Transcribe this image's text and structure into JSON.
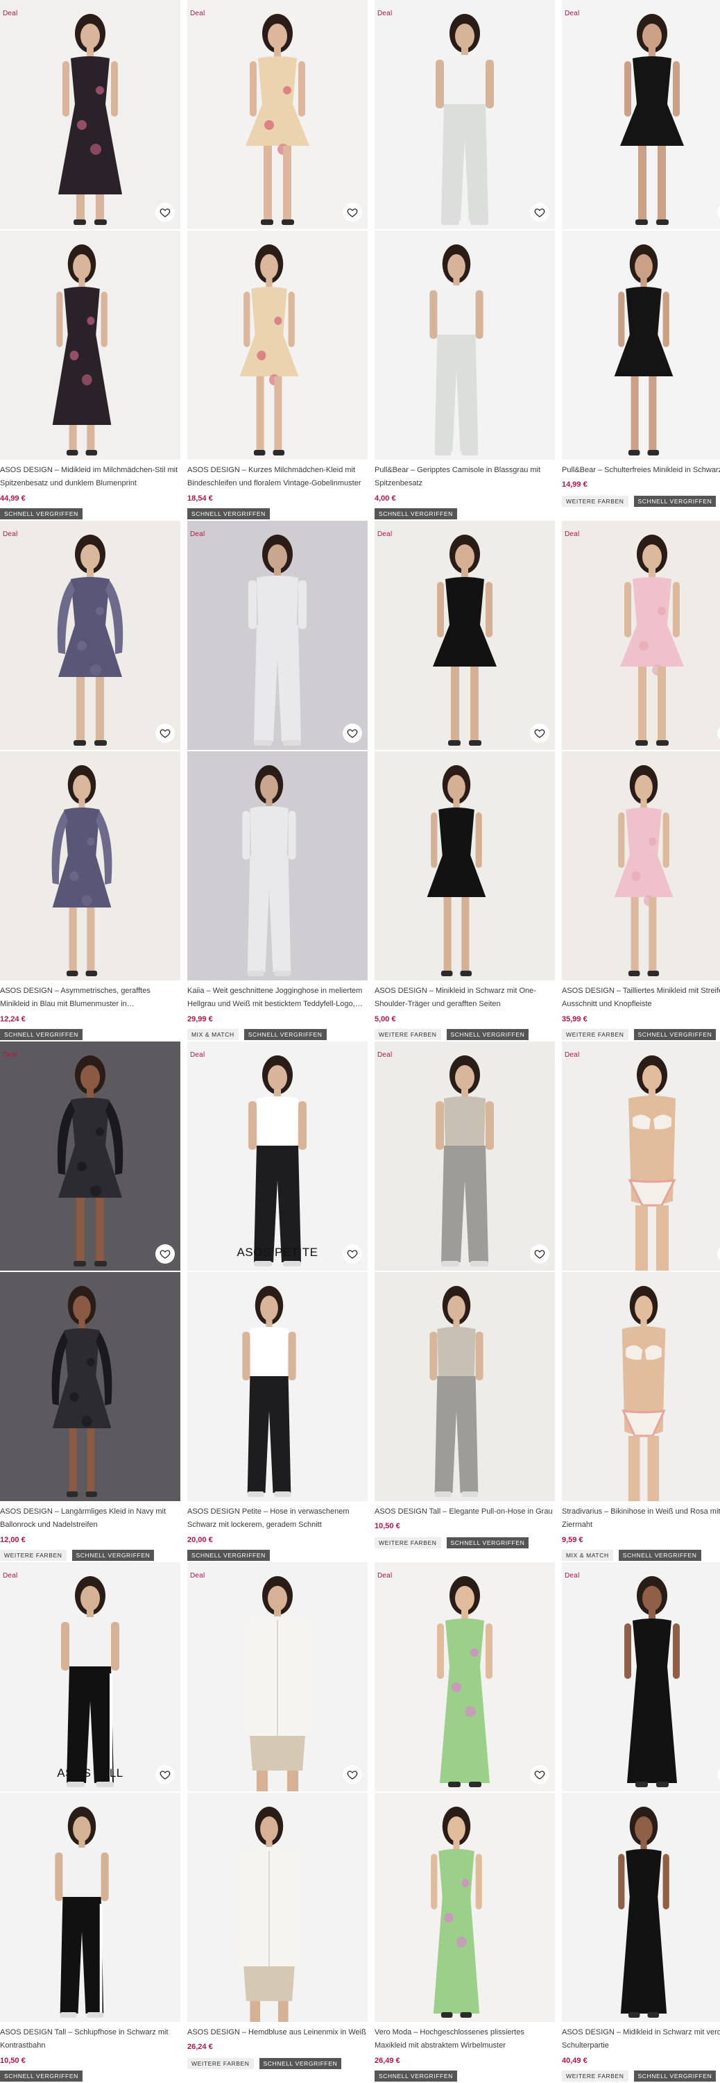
{
  "labels": {
    "deal": "Deal",
    "sold_out": "SCHNELL VERGRIFFEN",
    "more_colors": "WEITERE FARBEN",
    "mix_match": "MIX & MATCH"
  },
  "colors": {
    "deal_text": "#b4154a",
    "price_text": "#b4154a",
    "sold_out_tag_bg": "#555555",
    "more_colors_tag_bg": "#eeeeee"
  },
  "products": [
    {
      "title": "ASOS DESIGN – Midikleid im Milchmädchen-Stil mit Spitzenbesatz und dunklem Blumenprint",
      "price": "44,99 €",
      "deal": true,
      "sub_brand": "",
      "tags": [
        "sold_out"
      ],
      "image": {
        "bg": "#f1f0ee",
        "garment": "#2a2228",
        "accent": "#b05a78",
        "skin": "#d9b59c",
        "shape": "midi-dress"
      }
    },
    {
      "title": "ASOS DESIGN – Kurzes Milchmädchen-Kleid mit Bindeschleifen und floralem Vintage-Gobelinmuster",
      "price": "18,54 €",
      "deal": true,
      "sub_brand": "",
      "tags": [
        "sold_out"
      ],
      "image": {
        "bg": "#f3f2f0",
        "garment": "#ecd3b0",
        "accent": "#d8707a",
        "skin": "#dcb79c",
        "shape": "mini-dress"
      }
    },
    {
      "title": "Pull&Bear – Geripptes Camisole in Blassgrau mit Spitzenbesatz",
      "price": "4,00 €",
      "deal": true,
      "sub_brand": "",
      "tags": [
        "sold_out"
      ],
      "image": {
        "bg": "#f3f3f3",
        "garment": "#dcdedb",
        "accent": "#6b8fb5",
        "skin": "#d6b49a",
        "shape": "top-jeans"
      }
    },
    {
      "title": "Pull&Bear – Schulterfreies Minikleid in Schwarz",
      "price": "14,99 €",
      "deal": true,
      "sub_brand": "",
      "tags": [
        "more_colors",
        "sold_out"
      ],
      "image": {
        "bg": "#f4f4f4",
        "garment": "#141414",
        "accent": "#141414",
        "skin": "#caa187",
        "shape": "mini-dress"
      }
    },
    {
      "title": "ASOS DESIGN – Asymmetrisches, gerafftes Minikleid in Blau mit Blumenmuster in…",
      "price": "12,24 €",
      "deal": true,
      "sub_brand": "",
      "tags": [
        "sold_out"
      ],
      "image": {
        "bg": "#efece7",
        "garment": "#5a5677",
        "accent": "#6e6a8c",
        "skin": "#d9b79d",
        "shape": "longsleeve-dress"
      }
    },
    {
      "title": "Kaiia – Weit geschnittene Jogginghose in meliertem Hellgrau und Weiß mit besticktem Teddyfell-Logo,…",
      "price": "29,99 €",
      "deal": true,
      "sub_brand": "",
      "tags": [
        "mix_match",
        "sold_out"
      ],
      "image": {
        "bg": "#cfcdd1",
        "garment": "#e9e8ea",
        "accent": "#d6d5d8",
        "skin": "#c9a78f",
        "shape": "tracksuit"
      }
    },
    {
      "title": "ASOS DESIGN – Minikleid in Schwarz mit One-Shoulder-Träger und gerafften Seiten",
      "price": "5,00 €",
      "deal": true,
      "sub_brand": "",
      "tags": [
        "more_colors",
        "sold_out"
      ],
      "image": {
        "bg": "#efede9",
        "garment": "#121212",
        "accent": "#121212",
        "skin": "#d6b094",
        "shape": "mini-dress"
      }
    },
    {
      "title": "ASOS DESIGN – Tailliertes Minikleid mit Streifen, Ausschnitt und Knopfleiste",
      "price": "35,99 €",
      "deal": true,
      "sub_brand": "",
      "tags": [
        "more_colors",
        "sold_out"
      ],
      "image": {
        "bg": "#efece8",
        "garment": "#efc2cb",
        "accent": "#e7aab6",
        "skin": "#dcb89c",
        "shape": "mini-dress"
      }
    },
    {
      "title": "ASOS DESIGN – Langärmliges Kleid in Navy mit Ballonrock und Nadelstreifen",
      "price": "12,00 €",
      "deal": true,
      "sub_brand": "",
      "tags": [
        "more_colors",
        "sold_out"
      ],
      "image": {
        "bg": "#5d5a5f",
        "garment": "#2b2b30",
        "accent": "#1a1a1e",
        "skin": "#8a5a45",
        "shape": "longsleeve-dress"
      }
    },
    {
      "title": "ASOS DESIGN Petite – Hose in verwaschenem Schwarz mit lockerem, geradem Schnitt",
      "price": "20,00 €",
      "deal": true,
      "sub_brand": "ASOS PETITE",
      "tags": [
        "sold_out"
      ],
      "image": {
        "bg": "#f3f3f3",
        "garment": "#1d1d1f",
        "accent": "#ffffff",
        "skin": "#d8b59a",
        "shape": "trousers"
      }
    },
    {
      "title": "ASOS DESIGN Tall – Elegante Pull-on-Hose in Grau",
      "price": "10,50 €",
      "deal": true,
      "sub_brand": "",
      "tags": [
        "more_colors",
        "sold_out"
      ],
      "image": {
        "bg": "#eeece8",
        "garment": "#9d9c99",
        "accent": "#c8c0b2",
        "skin": "#d7b69c",
        "shape": "trousers"
      }
    },
    {
      "title": "Stradivarius – Bikinihose in Weiß und Rosa mit Zierrnaht",
      "price": "9,59 €",
      "deal": true,
      "sub_brand": "",
      "tags": [
        "mix_match",
        "sold_out"
      ],
      "image": {
        "bg": "#f1efed",
        "garment": "#f4efe9",
        "accent": "#e7a39a",
        "skin": "#e1bd9e",
        "shape": "bikini"
      }
    },
    {
      "title": "ASOS DESIGN Tall – Schlupfhose in Schwarz mit Kontrastbahn",
      "price": "10,50 €",
      "deal": true,
      "sub_brand": "ASOS TALL",
      "tags": [
        "sold_out"
      ],
      "image": {
        "bg": "#f3f3f3",
        "garment": "#111111",
        "accent": "#ffffff",
        "skin": "#d5b196",
        "shape": "top-jeans"
      }
    },
    {
      "title": "ASOS DESIGN – Hemdbluse aus Leinenmix in Weiß",
      "price": "26,24 €",
      "deal": true,
      "sub_brand": "",
      "tags": [
        "more_colors",
        "sold_out"
      ],
      "image": {
        "bg": "#f3f3f3",
        "garment": "#f5f4f0",
        "accent": "#d6c9b4",
        "skin": "#d6b196",
        "shape": "shirt"
      }
    },
    {
      "title": "Vero Moda – Hochgeschlossenes plissiertes Maxikleid mit abstraktem Wirbelmuster",
      "price": "26,49 €",
      "deal": true,
      "sub_brand": "",
      "tags": [
        "sold_out"
      ],
      "image": {
        "bg": "#f3f2f0",
        "garment": "#9ccf8a",
        "accent": "#d58bc7",
        "skin": "#e0bb9c",
        "shape": "maxi-dress"
      }
    },
    {
      "title": "ASOS DESIGN – Midikleid in Schwarz mit verdrehter Schulterpartie",
      "price": "40,49 €",
      "deal": true,
      "sub_brand": "",
      "tags": [
        "more_colors",
        "sold_out"
      ],
      "image": {
        "bg": "#f3f3f3",
        "garment": "#121212",
        "accent": "#121212",
        "skin": "#8f5f48",
        "shape": "maxi-dress"
      }
    }
  ]
}
